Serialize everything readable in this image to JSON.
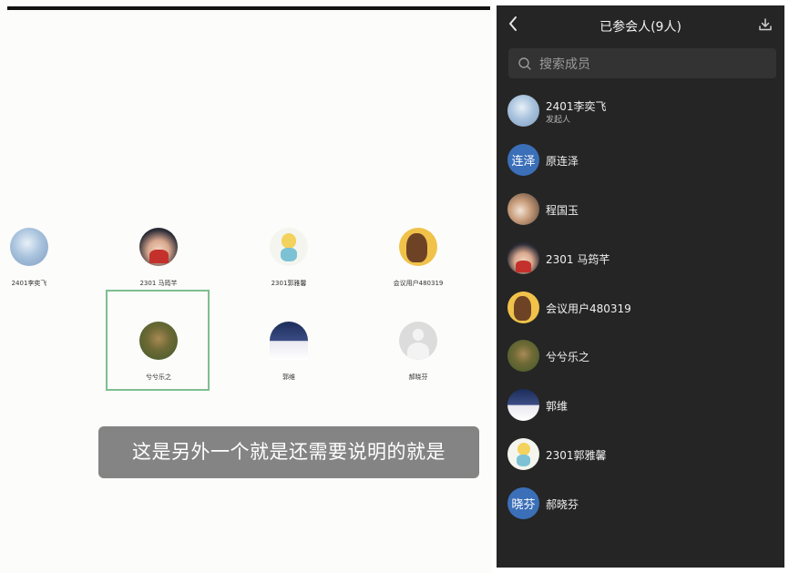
{
  "grid": {
    "tiles": [
      {
        "name": "2401李奕飞",
        "avatar": "sky-photo"
      },
      {
        "name": "2301 马筠芊",
        "avatar": "boy-illustration"
      },
      {
        "name": "2301郭雅馨",
        "avatar": "cartoon-child"
      },
      {
        "name": "会议用户480319",
        "avatar": "horse-cartoon"
      },
      {
        "name": "兮兮乐之",
        "avatar": "forest-photo"
      },
      {
        "name": "郭维",
        "avatar": "night-sky-photo"
      },
      {
        "name": "郝晓芬",
        "avatar": "default-person"
      }
    ],
    "caption": "这是另外一个就是还需要说明的就是"
  },
  "panel": {
    "title": "已参会人(9人)",
    "search_placeholder": "搜索成员",
    "members": [
      {
        "name": "2401李奕飞",
        "role": "发起人",
        "avatar": "sky-photo"
      },
      {
        "name": "原连泽",
        "avatar_text": "连泽",
        "avatar_color": "#3b6fb8"
      },
      {
        "name": "程国玉",
        "avatar": "cat-photo"
      },
      {
        "name": "2301 马筠芊",
        "avatar": "boy-illustration"
      },
      {
        "name": "会议用户480319",
        "avatar": "horse-cartoon"
      },
      {
        "name": "兮兮乐之",
        "avatar": "forest-photo"
      },
      {
        "name": "郭维",
        "avatar": "night-sky-photo"
      },
      {
        "name": "2301郭雅馨",
        "avatar": "cartoon-child"
      },
      {
        "name": "郝晓芬",
        "avatar_text": "晓芬",
        "avatar_color": "#3b6fb8"
      }
    ]
  },
  "icons": {
    "back": "chevron-left-icon",
    "download": "download-icon",
    "search": "search-icon"
  }
}
